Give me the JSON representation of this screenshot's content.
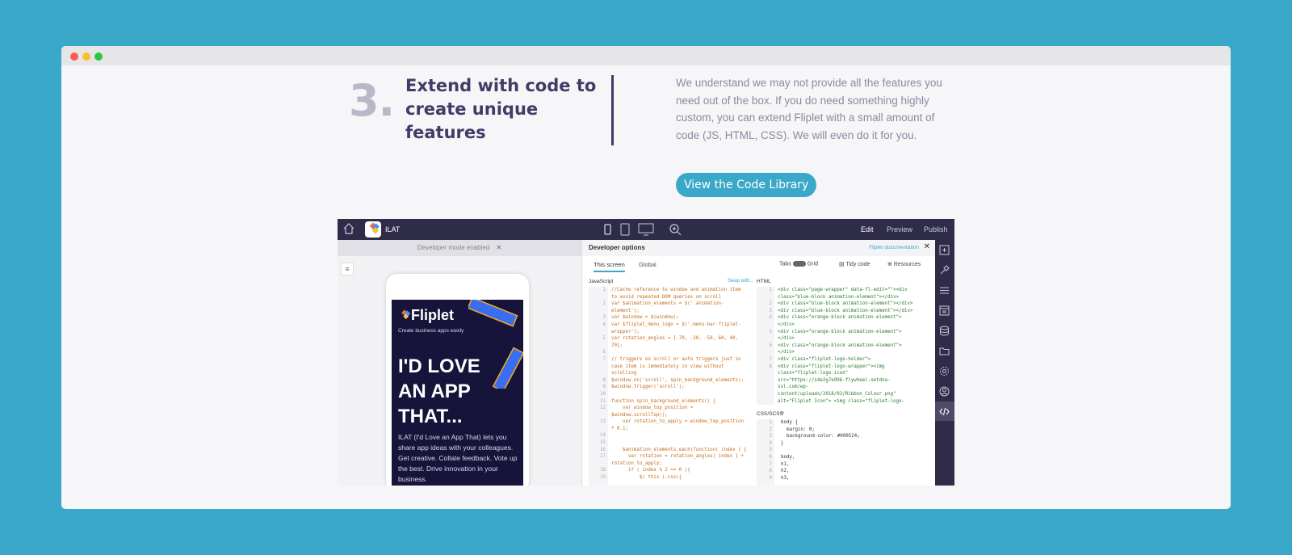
{
  "section": {
    "step_number": "3.",
    "heading": "Extend with code to create unique features",
    "paragraph": "We understand we may not provide all the features you need out of the box. If you do need something highly custom, you can extend Fliplet with a small amount of code (JS, HTML, CSS). We will even do it for you.",
    "cta_label": "View the Code Library"
  },
  "app": {
    "app_name": "ILAT",
    "nav": {
      "edit": "Edit",
      "preview": "Preview",
      "publish": "Publish"
    },
    "dev_mode_banner": "Developer mode enabled",
    "menu_glyph": "≡",
    "phone": {
      "brand": "Fliplet",
      "tagline": "Create business apps easily",
      "headline": "I'D LOVE AN APP THAT...",
      "body": "ILAT (I'd Love an App That) lets you share app ideas with your colleagues. Get creative. Collate feedback. Vote up the best. Drive innovation in your business."
    },
    "dev_panel": {
      "title": "Developer options",
      "doc_link": "Fliplet documentation",
      "close_glyph": "✕",
      "tabs": [
        "This screen",
        "Global"
      ],
      "tabs_toggle_label": "Tabs",
      "grid_label": "Grid",
      "tidy_label": "Tidy code",
      "resources_label": "Resources",
      "js_label": "JavaScript",
      "swap_label": "Swap with...",
      "html_label": "HTML",
      "css_label": "CSS/SCSS",
      "js_gutter": "1\n\n2\n\n3\n4\n\n5\n\n6\n7\n\n\n8\n9\n10\n11\n12\n\n13\n\n14\n15\n16\n17\n\n18\n19",
      "js_code": "//Cache reference to window and animation item\nto avoid repeated DOM queries on scroll\nvar $animation_elements = $('.animation-\nelement');\nvar $window = $(window);\nvar $fliplet_menu_logo = $('.menu-bar-fliplet-\nwrapper');\nvar rotation_angles = [-70, -20, -50, 60, 40,\n70];\n\n// triggers on scroll or auto triggers just in\ncase item is immediately in view without\nscrolling\n$window.on('scroll', spin_background_elements);\n$window.trigger('scroll');\n\nfunction spin_background_elements() {\n    var window_top_position =\n$window.scrollTop();\n    var rotation_to_apply = window_top_position\n* 0.1;\n\n\n    $animation_elements.each(function( index ) {\n      var rotation = rotation_angles[ index ] +\nrotation_to_apply;\n      if ( index % 2 == 0 ){\n          $( this ).css({",
      "html_gutter": "1\n\n2\n3\n4\n\n5\n\n6\n\n7\n8\n\n\n\n\n",
      "html_code": "<div class=\"page-wrapper\" data-fl-edit=\"\"><div\nclass=\"blue-block animation-element\"></div>\n<div class=\"blue-block animation-element\"></div>\n<div class=\"blue-block animation-element\"></div>\n<div class=\"orange-block animation-element\">\n</div>\n<div class=\"orange-block animation-element\">\n</div>\n<div class=\"orange-block animation-element\">\n</div>\n<div class=\"fliplet-logo-holder\">\n<div class=\"fliplet-logo-wrapper\"><img\nclass=\"fliplet-logo-icon\"\nsrc=\"https://s4e2g7e996-flywheel.netdna-\nssl.com/wp-\ncontent/uploads/2018/03/Ribbon_Colour.png\"\nalt=\"Fliplet Icon\"> <img class=\"fliplet-logo-",
      "css_gutter": "1\n2\n3\n4\n5\n6\n7\n8\n9",
      "css_code": "body {\n  margin: 0;\n  background-color: #000524;\n}\n\nbody,\nh1,\nh2,\nh3,"
    }
  },
  "colors": {
    "background": "#3aa8c8",
    "heading": "#3f3d66",
    "accent": "#3aa8c8",
    "app_dark": "#2f2c4a"
  }
}
